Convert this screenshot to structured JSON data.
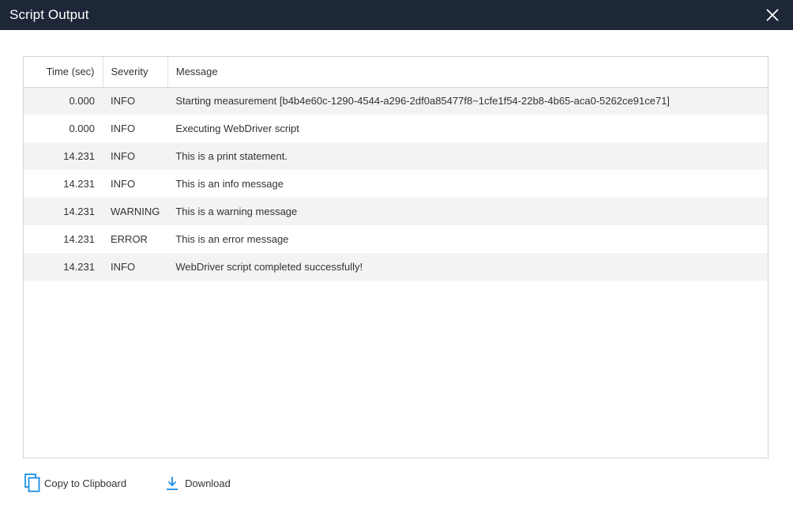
{
  "window": {
    "title": "Script Output"
  },
  "table": {
    "columns": {
      "time": "Time (sec)",
      "severity": "Severity",
      "message": "Message"
    },
    "rows": [
      {
        "time": "0.000",
        "severity": "INFO",
        "message": "Starting measurement [b4b4e60c-1290-4544-a296-2df0a85477f8~1cfe1f54-22b8-4b65-aca0-5262ce91ce71]"
      },
      {
        "time": "0.000",
        "severity": "INFO",
        "message": "Executing WebDriver script"
      },
      {
        "time": "14.231",
        "severity": "INFO",
        "message": "This is a print statement."
      },
      {
        "time": "14.231",
        "severity": "INFO",
        "message": "This is an info message"
      },
      {
        "time": "14.231",
        "severity": "WARNING",
        "message": "This is a warning message"
      },
      {
        "time": "14.231",
        "severity": "ERROR",
        "message": "This is an error message"
      },
      {
        "time": "14.231",
        "severity": "INFO",
        "message": "WebDriver script completed successfully!"
      }
    ]
  },
  "actions": {
    "copy_label": "Copy to Clipboard",
    "download_label": "Download"
  },
  "icons": {
    "close": "close-icon",
    "copy": "copy-icon",
    "download": "download-icon"
  },
  "colors": {
    "titlebar": "#1e2738",
    "accent": "#1a8fe3",
    "row_stripe": "#f3f3f3"
  }
}
